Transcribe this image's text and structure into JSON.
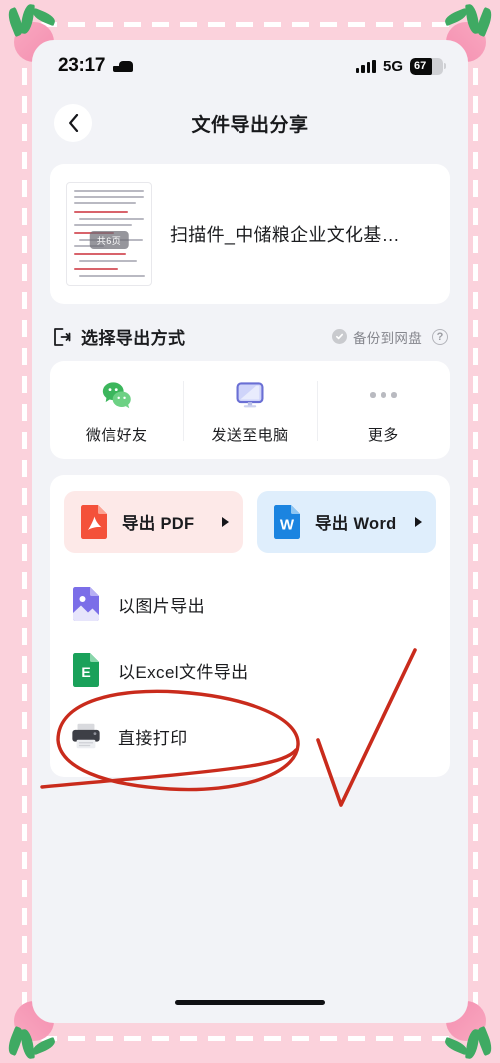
{
  "status_bar": {
    "time": "23:17",
    "alarm_icon": "bed-icon",
    "signal_icon": "signal-bars-icon",
    "network": "5G",
    "battery_level": "67",
    "battery_percent": 67
  },
  "nav": {
    "back_icon": "chevron-left-icon",
    "title": "文件导出分享"
  },
  "file": {
    "thumbnail_icon": "document-thumbnail",
    "page_badge": "共6页",
    "name": "扫描件_中储粮企业文化基…"
  },
  "section": {
    "icon": "export-icon",
    "title": "选择导出方式",
    "backup_check_icon": "check-circle-icon",
    "backup_label": "备份到网盘",
    "help_icon": "question-mark-icon",
    "help_label": "?"
  },
  "share_options": [
    {
      "icon": "wechat-icon",
      "label": "微信好友"
    },
    {
      "icon": "monitor-icon",
      "label": "发送至电脑"
    },
    {
      "icon": "more-dots-icon",
      "label": "更多"
    }
  ],
  "export_buttons": [
    {
      "icon": "pdf-file-icon",
      "label": "导出 PDF",
      "bg": "#fde9e8",
      "arrow_icon": "triangle-right-icon"
    },
    {
      "icon": "word-file-icon",
      "label": "导出 Word",
      "bg": "#dfeefc",
      "arrow_icon": "triangle-right-icon"
    }
  ],
  "export_list": [
    {
      "icon": "image-file-icon",
      "label": "以图片导出"
    },
    {
      "icon": "excel-file-icon",
      "label": "以Excel文件导出"
    },
    {
      "icon": "printer-icon",
      "label": "直接打印"
    }
  ],
  "annotations": {
    "circle_target": "直接打印",
    "circle_color": "#c92b1c",
    "check_color": "#c92b1c"
  },
  "decor": {
    "frame_color": "#fbd2dc",
    "dash_color": "#ffffff",
    "radish_bulb_color": "#f48fb0",
    "radish_leaf_color": "#3faa63"
  },
  "colors": {
    "screen_bg": "#f2f3f7",
    "card_bg": "#ffffff",
    "text_primary": "#1b1c1f",
    "text_secondary": "#85868d",
    "pdf_accent": "#f4513a",
    "word_accent": "#1b84e0",
    "excel_accent": "#1aa15a",
    "image_accent": "#7b6ee8",
    "wechat_accent": "#3cb65c"
  },
  "home_indicator": "home-indicator"
}
